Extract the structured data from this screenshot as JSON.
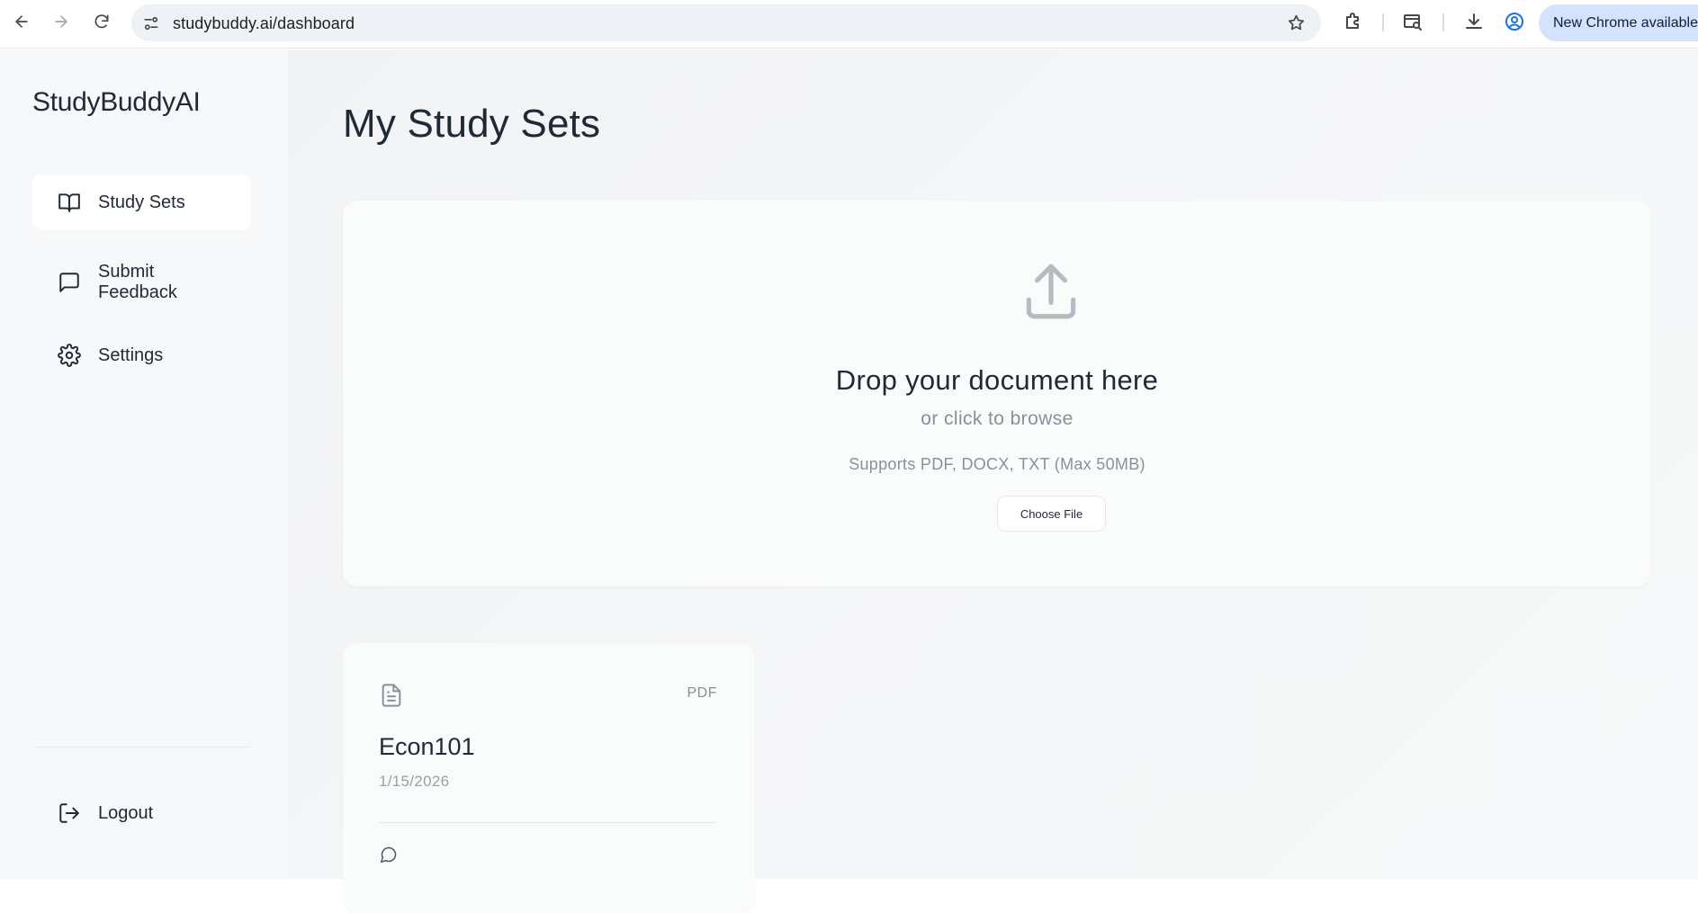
{
  "browser": {
    "url": "studybuddy.ai/dashboard",
    "update_label": "New Chrome available"
  },
  "sidebar": {
    "brand": "StudyBuddyAI",
    "items": [
      {
        "label": "Study Sets",
        "icon": "book-open-icon",
        "active": true
      },
      {
        "label": "Submit Feedback",
        "icon": "message-square-icon",
        "active": false
      },
      {
        "label": "Settings",
        "icon": "gear-icon",
        "active": false
      }
    ],
    "logout_label": "Logout"
  },
  "main": {
    "title": "My Study Sets",
    "upload": {
      "title": "Drop your document here",
      "subtitle": "or click to browse",
      "supported": "Supports PDF, DOCX, TXT (Max 50MB)",
      "button_label": "Choose File"
    },
    "study_sets": [
      {
        "title": "Econ101",
        "type": "PDF",
        "date": "1/15/2026"
      }
    ]
  }
}
